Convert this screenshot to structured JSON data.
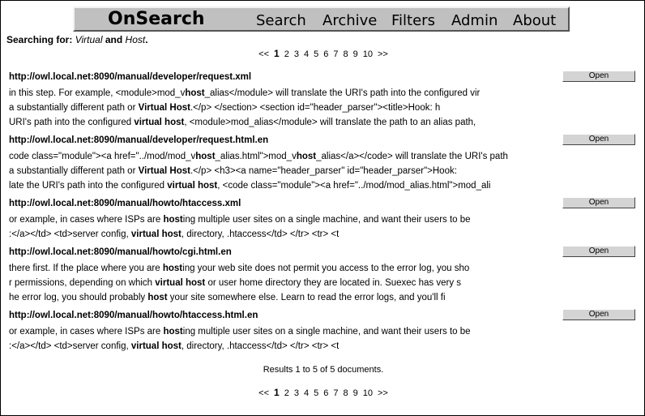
{
  "header": {
    "logo": "OnSearch",
    "nav": [
      "Search",
      "Archive",
      "Filters",
      "Admin",
      "About"
    ]
  },
  "query": {
    "prefix": "Searching for:",
    "term1": "Virtual",
    "joiner": "and",
    "term2": "Host",
    "suffix": "."
  },
  "pager": {
    "prev": "<<",
    "pages": [
      "1",
      "2",
      "3",
      "4",
      "5",
      "6",
      "7",
      "8",
      "9",
      "10"
    ],
    "current": "1",
    "next": ">>"
  },
  "open_label": "Open",
  "results": [
    {
      "url": "http://owl.local.net:8090/manual/developer/request.xml",
      "lines": [
        "in this step. For example, <module>mod_v**host**_alias</module> will translate the URI's path into the configured vir",
        "a substantially different path or **Virtual Host**.</p> </section> <section id=\"header_parser\"><title>Hook: h",
        "URI's path into the configured **virtual host**, <module>mod_alias</module> will translate the path to an alias path,"
      ]
    },
    {
      "url": "http://owl.local.net:8090/manual/developer/request.html.en",
      "lines": [
        "code class=\"module\"><a href=\"../mod/mod_v**host**_alias.html\">mod_v**host**_alias</a></code> will translate the URI's path",
        "a substantially different path or **Virtual Host**.</p> <h3><a name=\"header_parser\" id=\"header_parser\">Hook:",
        "late the URI's path into the configured **virtual host**, <code class=\"module\"><a href=\"../mod/mod_alias.html\">mod_ali"
      ]
    },
    {
      "url": "http://owl.local.net:8090/manual/howto/htaccess.xml",
      "lines": [
        "or example, in cases where ISPs are **host**ing multiple user sites on a single machine, and want their users to be",
        ":</a></td> <td>server config, **virtual host**, directory, .htaccess</td> </tr> <tr> <t"
      ]
    },
    {
      "url": "http://owl.local.net:8090/manual/howto/cgi.html.en",
      "lines": [
        "there first. If the place where you are **host**ing your web site does not permit you access to the error log, you sho",
        "r permissions, depending on which **virtual host** or user home directory they are located in. Suexec has very s",
        "he error log, you should probably **host** your site somewhere else. Learn to read the error logs, and you'll fi"
      ]
    },
    {
      "url": "http://owl.local.net:8090/manual/howto/htaccess.html.en",
      "lines": [
        "or example, in cases where ISPs are **host**ing multiple user sites on a single machine, and want their users to be",
        ":</a></td> <td>server config, **virtual host**, directory, .htaccess</td> </tr> <tr> <t"
      ]
    }
  ],
  "summary": "Results 1 to 5 of 5 documents."
}
